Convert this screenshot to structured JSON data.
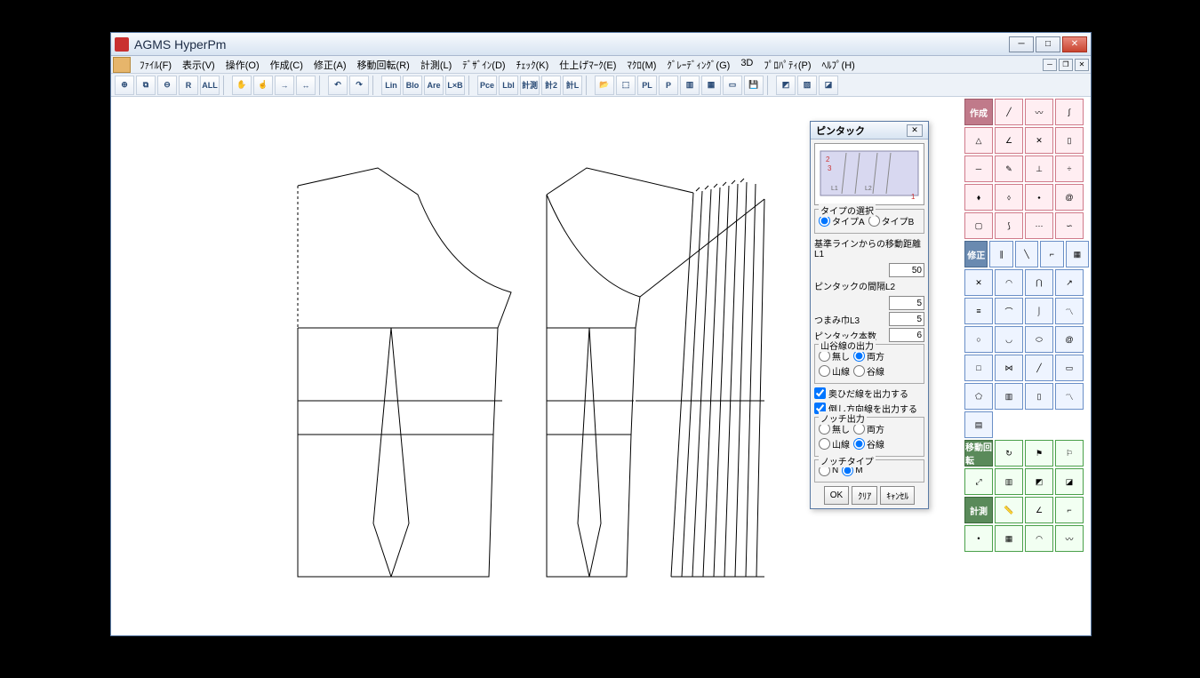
{
  "window": {
    "title": "AGMS HyperPm"
  },
  "menu": {
    "items": [
      "ﾌｧｲﾙ(F)",
      "表示(V)",
      "操作(O)",
      "作成(C)",
      "修正(A)",
      "移動回転(R)",
      "計測(L)",
      "ﾃﾞｻﾞｲﾝ(D)",
      "ﾁｪｯｸ(K)",
      "仕上げﾏｰｸ(E)",
      "ﾏｸﾛ(M)",
      "ｸﾞﾚｰﾃﾞｨﾝｸﾞ(G)",
      "3D",
      "ﾌﾟﾛﾊﾟﾃｨ(P)",
      "ﾍﾙﾌﾟ(H)"
    ]
  },
  "toolbar": {
    "groups": [
      [
        "zoom-in",
        "zoom-rect",
        "zoom-out",
        "R",
        "ALL"
      ],
      [
        "hand",
        "point",
        "arrow-right",
        "arrow-cross"
      ],
      [
        "undo",
        "redo"
      ],
      [
        "Line",
        "Bloc",
        "Area",
        "LxB"
      ],
      [
        "Piece",
        "Label",
        "計測",
        "計測2",
        "計Label"
      ],
      [
        "open",
        "pattern",
        "Piece-Label",
        "P",
        "columns",
        "grid",
        "rect",
        "save"
      ],
      [
        "tool-a",
        "tool-b",
        "tool-c"
      ]
    ]
  },
  "palette": {
    "sections": [
      {
        "header": "作成",
        "color": "pink",
        "rows": [
          [
            "line-diag",
            "line-curve",
            "line-s"
          ],
          [
            "skirt",
            "angle",
            "cross",
            "panel"
          ],
          [
            "line",
            "pencil",
            "perp",
            "divide"
          ],
          [
            "bottle-1",
            "bottle-2",
            "bottle-3",
            "spiral-sm"
          ],
          [
            "rect",
            "curve-2",
            "dots",
            "s-curve"
          ]
        ]
      },
      {
        "header": "修正",
        "color": "blue",
        "rows": [
          [
            "lines-v",
            "diag",
            "corner",
            "mesh"
          ],
          [
            "cross-x",
            "arc-up",
            "intersect",
            "arrow"
          ],
          [
            "h-lines",
            "curve-d",
            "curve-j",
            "zigzag"
          ],
          [
            "circle",
            "arc",
            "cylinder",
            "spiral"
          ],
          [
            "square",
            "join",
            "diag-2",
            "rect-2"
          ],
          [
            "trap",
            "bars",
            "panel-2",
            "zigzag-2"
          ],
          [
            "book",
            "",
            "",
            ""
          ]
        ]
      },
      {
        "header": "移動回転",
        "color": "green",
        "rows": [
          [
            "rotate",
            "flag",
            "flag-2"
          ],
          [
            "scale",
            "bars-2",
            "fold",
            "fold-2"
          ]
        ]
      },
      {
        "header": "計測",
        "color": "green",
        "rows": [
          [
            "ruler",
            "angle-m",
            "corner-m"
          ],
          [
            "point-m",
            "grid-m",
            "arc-m",
            "zig-m"
          ]
        ]
      }
    ]
  },
  "dialog": {
    "title": "ピンタック",
    "typeSelect": {
      "label": "タイプの選択",
      "a": "タイプA",
      "b": "タイプB",
      "selected": "A"
    },
    "distL1": {
      "label": "基準ラインからの移動距離L1",
      "value": "50"
    },
    "gapL2": {
      "label": "ピンタックの間隔L2",
      "value": "5"
    },
    "widthL3": {
      "label": "つまみ巾L3",
      "value": "5"
    },
    "count": {
      "label": "ピンタック本数",
      "value": "6"
    },
    "outputLines": {
      "label": "山谷線の出力",
      "none": "無し",
      "both": "両方",
      "yama": "山線",
      "tani": "谷線",
      "selected": "both"
    },
    "checkFold": {
      "label": "奥ひだ線を出力する",
      "checked": true
    },
    "checkDir": {
      "label": "倒し方向線を出力する",
      "checked": true
    },
    "notchOut": {
      "label": "ノッチ出力",
      "none": "無し",
      "both": "両方",
      "yama": "山線",
      "tani": "谷線",
      "selected": "tani"
    },
    "notchType": {
      "label": "ノッチタイプ",
      "n": "N",
      "m": "M",
      "selected": "M"
    },
    "btnOk": "OK",
    "btnClear": "ｸﾘｱ",
    "btnCancel": "ｷｬﾝｾﾙ"
  }
}
